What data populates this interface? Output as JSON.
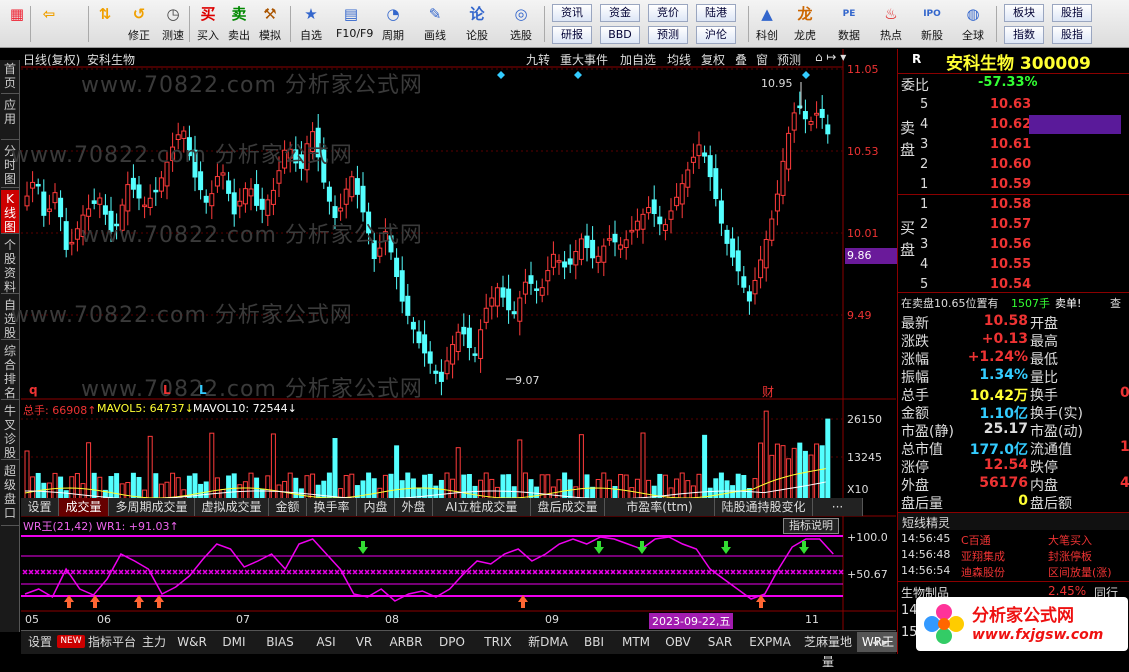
{
  "toolbar": {
    "buttons": [
      {
        "label": "",
        "icon": "grid-icon",
        "color": "#e23"
      },
      {
        "label": "",
        "icon": "back-arrow-icon",
        "color": "#f0a000"
      },
      {
        "label": "",
        "icon": "up-down-arrows-icon",
        "color": "#f0a000"
      },
      {
        "label": "修正",
        "icon": "restore-icon",
        "color": "#f0a000"
      },
      {
        "label": "测速",
        "icon": "clock-icon",
        "color": "#444"
      },
      {
        "label": "买入",
        "icon": "buy-icon",
        "color": "#d00"
      },
      {
        "label": "卖出",
        "icon": "sell-icon",
        "color": "#080"
      },
      {
        "label": "模拟",
        "icon": "hammer-icon",
        "color": "#a50"
      },
      {
        "label": "自选",
        "icon": "star-icon",
        "color": "#36c"
      },
      {
        "label": "F10/F9",
        "icon": "info-icon",
        "color": "#36c"
      },
      {
        "label": "周期",
        "icon": "period-icon",
        "color": "#36c"
      },
      {
        "label": "画线",
        "icon": "pencil-icon",
        "color": "#36c"
      },
      {
        "label": "论股",
        "icon": "discuss-icon",
        "color": "#36c"
      },
      {
        "label": "选股",
        "icon": "target-icon",
        "color": "#36c"
      },
      {
        "label": "科创",
        "icon": "tech-icon",
        "color": "#36c"
      },
      {
        "label": "龙虎",
        "icon": "dragon-icon",
        "color": "#c60"
      },
      {
        "label": "数据",
        "icon": "pe-icon",
        "color": "#36c"
      },
      {
        "label": "热点",
        "icon": "fire-icon",
        "color": "#d00"
      },
      {
        "label": "新股",
        "icon": "ipo-icon",
        "color": "#36c"
      },
      {
        "label": "全球",
        "icon": "globe-icon",
        "color": "#36c"
      }
    ],
    "small_buttons": [
      "资讯",
      "资金",
      "竞价",
      "陆港",
      "研报",
      "BBD",
      "预测",
      "沪伦",
      "板块",
      "股指",
      "股指",
      "指数"
    ]
  },
  "chart_header": {
    "period": "日线(复权)",
    "stock_name": "安科生物",
    "watermark": "www.70822.com 分析家公式网",
    "tools": [
      "九转",
      "重大事件",
      "加自选",
      "均线",
      "复权",
      "叠",
      "窗",
      "预测"
    ]
  },
  "price_axis": {
    "labels": [
      "11.05",
      "10.53",
      "10.01",
      "9.49"
    ],
    "current": "9.86"
  },
  "annotations": {
    "high": "10.95",
    "low": "9.07",
    "marks": [
      "q",
      "L",
      "L",
      "财"
    ]
  },
  "volume_legend": {
    "total": "总手: 66908↑",
    "mavol5": "MAVOL5: 64737↓",
    "mavol10": "MAVOL10: 72544↓",
    "axis": [
      "26150",
      "13245",
      "X10"
    ]
  },
  "sub_tabs": [
    "设置",
    "成交量",
    "多周期成交量",
    "虚拟成交量",
    "金额",
    "换手率",
    "内盘",
    "外盘",
    "AI立桩成交量",
    "盘后成交量",
    "市盈率(ttm)",
    "陆股通持股变化",
    "···"
  ],
  "indicator": {
    "legend": "WR王(21,42)  WR1: +91.03↑",
    "button": "指标说明",
    "axis": [
      "+100.0",
      "+50.67"
    ]
  },
  "date_axis": {
    "labels": [
      "05",
      "06",
      "07",
      "08",
      "09",
      "10",
      "11"
    ],
    "cursor": "2023-09-22,五"
  },
  "bottom_tabs": [
    "设置",
    "NEW",
    "指标平台",
    "主力",
    "W&R",
    "DMI",
    "BIAS",
    "ASI",
    "VR",
    "ARBR",
    "DPO",
    "TRIX",
    "新DMA",
    "BBI",
    "MTM",
    "OBV",
    "SAR",
    "EXPMA",
    "芝麻量地量",
    "WR王"
  ],
  "side_tabs": [
    "首页",
    "应用",
    "分时图",
    "K线图",
    "个股资料",
    "自选股",
    "综合排名",
    "牛叉诊股",
    "超级盘口"
  ],
  "quote": {
    "title": "安科生物 300009",
    "weibi_label": "委比",
    "weibi": "-57.33%",
    "sell_label": [
      "卖",
      "盘"
    ],
    "buy_label": [
      "买",
      "盘"
    ],
    "sells": [
      {
        "n": "5",
        "p": "10.63"
      },
      {
        "n": "4",
        "p": "10.62"
      },
      {
        "n": "3",
        "p": "10.61"
      },
      {
        "n": "2",
        "p": "10.60"
      },
      {
        "n": "1",
        "p": "10.59"
      }
    ],
    "buys": [
      {
        "n": "1",
        "p": "10.58"
      },
      {
        "n": "2",
        "p": "10.57"
      },
      {
        "n": "3",
        "p": "10.56"
      },
      {
        "n": "4",
        "p": "10.55"
      },
      {
        "n": "5",
        "p": "10.54"
      }
    ],
    "notice": "在卖盘10.65位置有",
    "notice_qty": "1507手",
    "notice_act": "卖单!",
    "notice_more": "查",
    "stats": [
      {
        "k": "最新",
        "v": "10.58",
        "k2": "开盘",
        "c": "#e33"
      },
      {
        "k": "涨跌",
        "v": "+0.13",
        "k2": "最高",
        "c": "#e33"
      },
      {
        "k": "涨幅",
        "v": "+1.24%",
        "k2": "最低",
        "c": "#e33"
      },
      {
        "k": "振幅",
        "v": "1.34%",
        "k2": "量比",
        "c": "#3cf"
      },
      {
        "k": "总手",
        "v": "10.42万",
        "k2": "换手",
        "c": "#ff3"
      },
      {
        "k": "金额",
        "v": "1.10亿",
        "k2": "换手(实)",
        "c": "#3cf"
      },
      {
        "k": "市盈(静)",
        "v": "25.17",
        "k2": "市盈(动)",
        "c": "#ddd"
      },
      {
        "k": "总市值",
        "v": "177.0亿",
        "k2": "流通值",
        "c": "#3cf"
      },
      {
        "k": "涨停",
        "v": "12.54",
        "k2": "跌停",
        "c": "#e33"
      },
      {
        "k": "外盘",
        "v": "56176",
        "k2": "内盘",
        "c": "#e33"
      },
      {
        "k": "盘后量",
        "v": "0",
        "k2": "盘后额",
        "c": "#ff3"
      }
    ],
    "stats_right": [
      "",
      "",
      "",
      "",
      "0",
      "",
      "",
      "12",
      "",
      "4",
      ""
    ],
    "short_title": "短线精灵",
    "shorts": [
      {
        "t": "14:56:45",
        "name": "C百通",
        "evt": "大笔买入",
        "c": "#e33"
      },
      {
        "t": "14:56:48",
        "name": "亚翔集成",
        "evt": "封涨停板",
        "c": "#e33"
      },
      {
        "t": "14:56:54",
        "name": "迪森股份",
        "evt": "区间放量(涨)",
        "c": "#e33"
      }
    ],
    "sector": "生物制品",
    "sector_pct": "2.45%",
    "sector_more": "同行"
  },
  "logo": {
    "text": "分析家公式网",
    "url": "www.fxjgsw.com"
  },
  "chart_data": {
    "type": "candlestick",
    "title": "安科生物 300009 日线(复权)",
    "ylim": [
      9.0,
      11.1
    ],
    "high": 10.95,
    "low": 9.07,
    "last": 10.58,
    "candles_approx": [
      [
        10.22,
        10.28,
        10.15,
        10.2
      ],
      [
        10.2,
        10.26,
        10.05,
        10.1
      ],
      [
        10.1,
        10.18,
        10.0,
        10.15
      ],
      [
        10.15,
        10.32,
        10.12,
        10.28
      ],
      [
        10.28,
        10.3,
        10.12,
        10.18
      ],
      [
        10.18,
        10.25,
        10.05,
        10.08
      ],
      [
        10.08,
        10.15,
        9.92,
        9.95
      ],
      [
        9.95,
        10.05,
        9.9,
        10.0
      ],
      [
        10.0,
        10.12,
        9.98,
        10.1
      ],
      [
        10.1,
        10.2,
        10.0,
        10.05
      ],
      [
        10.05,
        10.1,
        9.85,
        9.88
      ],
      [
        9.88,
        9.98,
        9.8,
        9.92
      ],
      [
        9.92,
        10.05,
        9.9,
        10.02
      ],
      [
        10.02,
        10.12,
        9.96,
        9.98
      ],
      [
        9.98,
        10.05,
        9.85,
        9.9
      ],
      [
        9.9,
        10.0,
        9.85,
        9.96
      ],
      [
        9.96,
        10.15,
        9.94,
        10.12
      ],
      [
        10.12,
        10.2,
        10.05,
        10.08
      ],
      [
        10.08,
        10.25,
        10.06,
        10.22
      ],
      [
        10.22,
        10.3,
        10.1,
        10.14
      ],
      [
        10.14,
        10.2,
        10.0,
        10.04
      ],
      [
        10.04,
        10.1,
        9.9,
        9.95
      ],
      [
        9.95,
        10.1,
        9.92,
        10.06
      ],
      [
        10.06,
        10.18,
        10.02,
        10.12
      ],
      [
        10.12,
        10.35,
        10.1,
        10.3
      ],
      [
        10.3,
        10.38,
        10.15,
        10.18
      ],
      [
        10.18,
        10.28,
        10.05,
        10.1
      ],
      [
        10.1,
        10.2,
        10.0,
        10.16
      ],
      [
        10.16,
        10.28,
        10.12,
        10.24
      ],
      [
        10.24,
        10.3,
        10.05,
        10.08
      ]
    ],
    "series_note": "approximate daily OHLC from May to Nov; full candle set is rendered in the chart"
  }
}
